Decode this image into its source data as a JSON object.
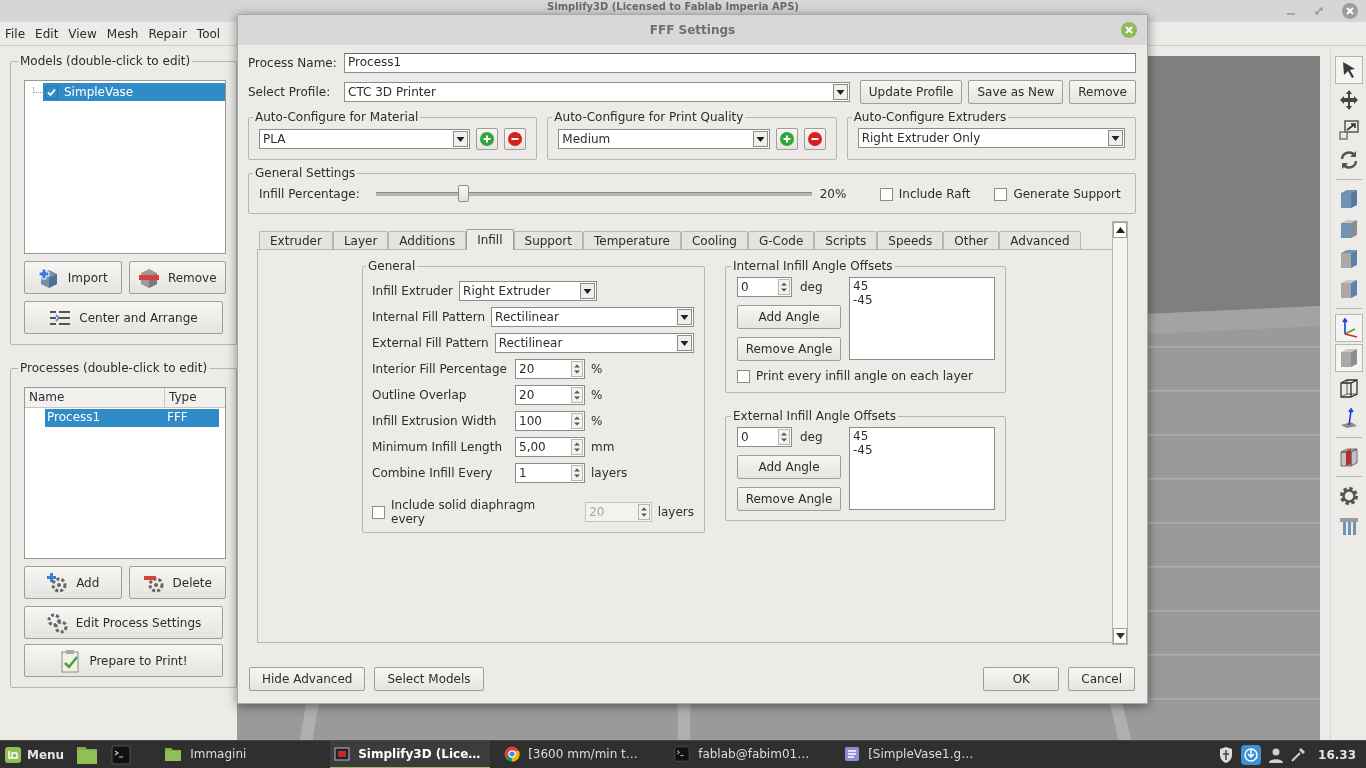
{
  "main_window": {
    "title": "Simplify3D (Licensed to Fablab Imperia APS)"
  },
  "menu": [
    "File",
    "Edit",
    "View",
    "Mesh",
    "Repair",
    "Tool"
  ],
  "models_panel": {
    "title": "Models (double-click to edit)",
    "items": [
      {
        "label": "SimpleVase",
        "checked": true,
        "selected": true
      }
    ],
    "buttons": [
      {
        "kind": "import",
        "label": "Import"
      },
      {
        "kind": "remove",
        "label": "Remove"
      },
      {
        "kind": "arrange",
        "label": "Center and Arrange"
      }
    ]
  },
  "processes_panel": {
    "title": "Processes (double-click to edit)",
    "columns": [
      "Name",
      "Type"
    ],
    "rows": [
      {
        "cells": [
          "Process1",
          "FFF"
        ],
        "selected": true
      }
    ],
    "buttons": [
      {
        "kind": "add",
        "label": "Add"
      },
      {
        "kind": "delete",
        "label": "Delete"
      },
      {
        "kind": "edit",
        "label": "Edit Process Settings"
      },
      {
        "kind": "prepare",
        "label": "Prepare to Print!"
      }
    ]
  },
  "toolbar": [
    {
      "kind": "select",
      "selected": true
    },
    {
      "kind": "move",
      "selected": false
    },
    {
      "kind": "scale",
      "selected": false
    },
    {
      "kind": "rotate",
      "selected": false
    },
    {
      "kind": "separator"
    },
    {
      "kind": "cube-top",
      "selected": false
    },
    {
      "kind": "cube-front",
      "selected": false
    },
    {
      "kind": "cube-left",
      "selected": false
    },
    {
      "kind": "cube-right",
      "selected": false
    },
    {
      "kind": "separator"
    },
    {
      "kind": "axes",
      "selected": true
    },
    {
      "kind": "solid",
      "selected": true
    },
    {
      "kind": "wireframe",
      "selected": false
    },
    {
      "kind": "normal",
      "selected": false
    },
    {
      "kind": "separator"
    },
    {
      "kind": "section",
      "selected": false
    },
    {
      "kind": "separator"
    },
    {
      "kind": "gear",
      "selected": false
    },
    {
      "kind": "bars",
      "selected": false
    }
  ],
  "dialog": {
    "title": "FFF Settings",
    "process_name": {
      "label": "Process Name:",
      "value": "Process1"
    },
    "profile": {
      "label": "Select Profile:",
      "value": "CTC 3D Printer",
      "buttons": [
        "Update Profile",
        "Save as New",
        "Remove"
      ]
    },
    "auto_configure": [
      {
        "title": "Auto-Configure for Material",
        "value": "PLA",
        "add_remove": true
      },
      {
        "title": "Auto-Configure for Print Quality",
        "value": "Medium",
        "add_remove": true
      },
      {
        "title": "Auto-Configure Extruders",
        "value": "Right Extruder Only",
        "add_remove": false
      }
    ],
    "general_settings": {
      "title": "General Settings",
      "slider": {
        "label": "Infill Percentage:",
        "level": 0.2,
        "reading": "20%"
      },
      "checkboxes": [
        {
          "label": "Include Raft",
          "checked": false
        },
        {
          "label": "Generate Support",
          "checked": false
        }
      ]
    },
    "tabs": [
      {
        "label": "Extruder",
        "selected": false
      },
      {
        "label": "Layer",
        "selected": false
      },
      {
        "label": "Additions",
        "selected": false
      },
      {
        "label": "Infill",
        "selected": true
      },
      {
        "label": "Support",
        "selected": false
      },
      {
        "label": "Temperature",
        "selected": false
      },
      {
        "label": "Cooling",
        "selected": false
      },
      {
        "label": "G-Code",
        "selected": false
      },
      {
        "label": "Scripts",
        "selected": false
      },
      {
        "label": "Speeds",
        "selected": false
      },
      {
        "label": "Other",
        "selected": false
      },
      {
        "label": "Advanced",
        "selected": false
      }
    ],
    "infill": {
      "general": {
        "title": "General",
        "rows": [
          {
            "kind": "dropdown",
            "label": "Infill Extruder",
            "value": "Right Extruder"
          },
          {
            "kind": "dropdown",
            "label": "Internal Fill Pattern",
            "value": "Rectilinear"
          },
          {
            "kind": "dropdown",
            "label": "External Fill Pattern",
            "value": "Rectilinear"
          },
          {
            "kind": "spin",
            "label": "Interior Fill Percentage",
            "value": "20",
            "unit": "%"
          },
          {
            "kind": "spin",
            "label": "Outline Overlap",
            "value": "20",
            "unit": "%"
          },
          {
            "kind": "spin",
            "label": "Infill Extrusion Width",
            "value": "100",
            "unit": "%"
          },
          {
            "kind": "spin",
            "label": "Minimum Infill Length",
            "value": "5,00",
            "unit": "mm"
          },
          {
            "kind": "spin",
            "label": "Combine Infill Every",
            "value": "1",
            "unit": "layers"
          }
        ],
        "diaphragm": {
          "label": "Include solid diaphragm every",
          "checked": false,
          "value": "20",
          "unit": "layers",
          "disabled": true
        }
      },
      "angle_groups": [
        {
          "title": "Internal Infill Angle Offsets",
          "value": "0",
          "unit": "deg",
          "buttons": [
            "Add Angle",
            "Remove Angle"
          ],
          "angles": [
            "45",
            "-45"
          ],
          "option": {
            "label": "Print every infill angle on each layer",
            "checked": false
          }
        },
        {
          "title": "External Infill Angle Offsets",
          "value": "0",
          "unit": "deg",
          "buttons": [
            "Add Angle",
            "Remove Angle"
          ],
          "angles": [
            "45",
            "-45"
          ]
        }
      ]
    },
    "left_buttons": [
      "Hide Advanced",
      "Select Models"
    ],
    "right_buttons": [
      "OK",
      "Cancel"
    ]
  },
  "taskbar": {
    "menu": "Menu",
    "launchers": [
      {
        "kind": "files"
      },
      {
        "kind": "terminal"
      }
    ],
    "windows": [
      {
        "kind": "folder",
        "label": "Immagini",
        "selected": false
      },
      {
        "kind": "app",
        "label": "Simplify3D (Lice…",
        "selected": true
      },
      {
        "kind": "browser",
        "label": "[3600 mm/min t…",
        "selected": false
      },
      {
        "kind": "terminal",
        "label": "fablab@fabim01…",
        "selected": false
      },
      {
        "kind": "editor",
        "label": "[SimpleVase1.g…",
        "selected": false
      }
    ],
    "tray": [
      {
        "kind": "shield"
      },
      {
        "kind": "update"
      },
      {
        "kind": "user"
      },
      {
        "kind": "network"
      }
    ],
    "clock": "16.33"
  }
}
